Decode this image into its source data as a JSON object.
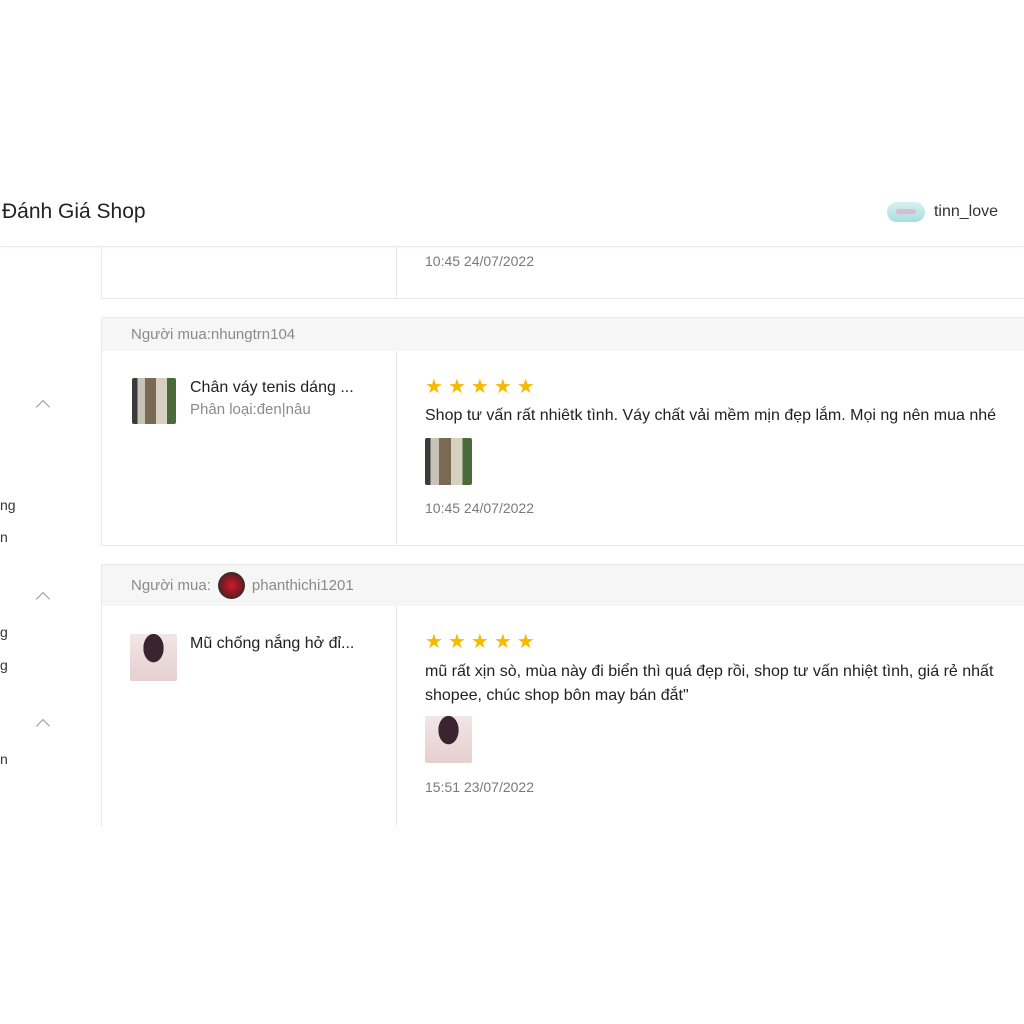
{
  "header": {
    "title": "Đánh Giá Shop",
    "account_name": "tinn_love",
    "account_logo_icon": "shop-logo-icon"
  },
  "sidebar": {
    "fragments": [
      "ng",
      "n",
      "g",
      "g",
      "n"
    ]
  },
  "reviews": [
    {
      "timestamp": "10:45 24/07/2022"
    },
    {
      "buyer_label": "Người mua:",
      "buyer_name": "nhungtrn104",
      "product_name": "Chân váy tenis dáng ...",
      "product_variant": "Phân loại:đen|nâu",
      "rating": 5,
      "text": "Shop tư vấn rất nhiêtk tình. Váy chất vải mềm mịn đẹp lắm. Mọi ng nên mua nhé",
      "timestamp": "10:45 24/07/2022"
    },
    {
      "buyer_label": "Người mua:",
      "buyer_name": "phanthichi1201",
      "product_name": "Mũ chống nắng hở đỉ...",
      "rating": 5,
      "text": "mũ rất xịn sò, mùa này đi biển thì quá đẹp rồi, shop tư vấn nhiệt tình, giá rẻ nhất shopee, chúc shop bôn may bán đắt\"",
      "timestamp": "15:51 23/07/2022"
    }
  ],
  "colors": {
    "star": "#f6b900",
    "muted_text": "#8a8a8a",
    "border": "#e8e8e8",
    "card_head_bg": "#f6f6f6"
  }
}
